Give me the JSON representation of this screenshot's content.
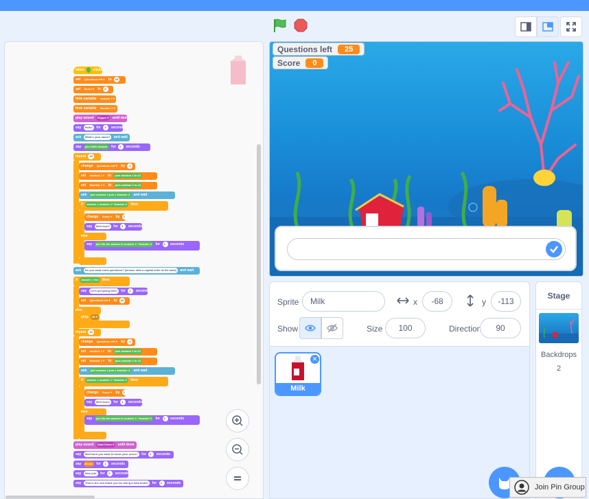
{
  "monitors": {
    "questions_label": "Questions left",
    "questions_value": "25",
    "score_label": "Score",
    "score_value": "0"
  },
  "sprite_info": {
    "sprite_label": "Sprite",
    "sprite_name": "Milk",
    "x_label": "x",
    "x_value": "-68",
    "y_label": "y",
    "y_value": "-113",
    "show_label": "Show",
    "size_label": "Size",
    "size_value": "100",
    "direction_label": "Direction",
    "direction_value": "90"
  },
  "sprites": [
    {
      "name": "Milk"
    }
  ],
  "stage_pane": {
    "title": "Stage",
    "backdrops_label": "Backdrops",
    "backdrops_count": "2"
  },
  "pin_group": {
    "label": "Join Pin Group"
  },
  "colors": {
    "accent": "#4c97ff",
    "variables": "#ff8c1a",
    "control": "#ffab19",
    "looks": "#9966ff",
    "operators": "#59c059",
    "sensing": "#5cb1d6",
    "sound": "#cf63cf",
    "events": "#ffbf00"
  },
  "icons": [
    "green-flag-icon",
    "stop-icon",
    "small-stage-icon",
    "large-stage-icon",
    "fullscreen-icon",
    "zoom-in-icon",
    "zoom-out-icon",
    "zoom-reset-icon",
    "eye-icon",
    "eye-slash-icon",
    "checkmark-icon",
    "choose-sprite-icon",
    "choose-backdrop-icon",
    "user-icon"
  ]
}
